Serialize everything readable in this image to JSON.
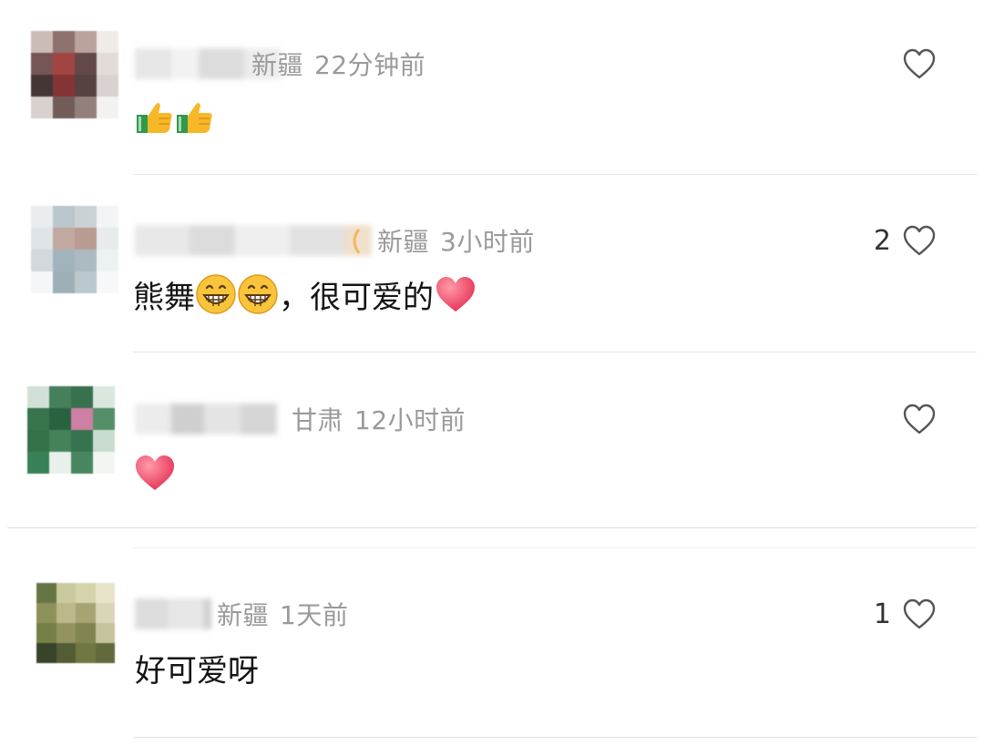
{
  "comments": [
    {
      "region": "新疆",
      "time": "22分钟前",
      "text": "",
      "emojis": [
        "thumbs-up",
        "thumbs-up"
      ],
      "likes": ""
    },
    {
      "region": "新疆",
      "time": "3小时前",
      "text_a": "熊舞",
      "text_b": "，很可爱的",
      "emojis": [
        "grinning",
        "grinning",
        "red-heart"
      ],
      "likes": "2"
    },
    {
      "region": "甘肃",
      "time": "12小时前",
      "text": "",
      "emojis": [
        "red-heart"
      ],
      "likes": ""
    },
    {
      "region": "新疆",
      "time": "1天前",
      "text": "好可爱呀",
      "emojis": [],
      "likes": "1"
    }
  ],
  "icons": {
    "like": "heart-outline-icon"
  },
  "colors": {
    "meta_text": "#9a9a9a",
    "divider": "#e4e4e4",
    "heart_fill": "#e8385a",
    "thumb_yellow": "#f7b828",
    "cuff_green": "#2e9a4a"
  }
}
